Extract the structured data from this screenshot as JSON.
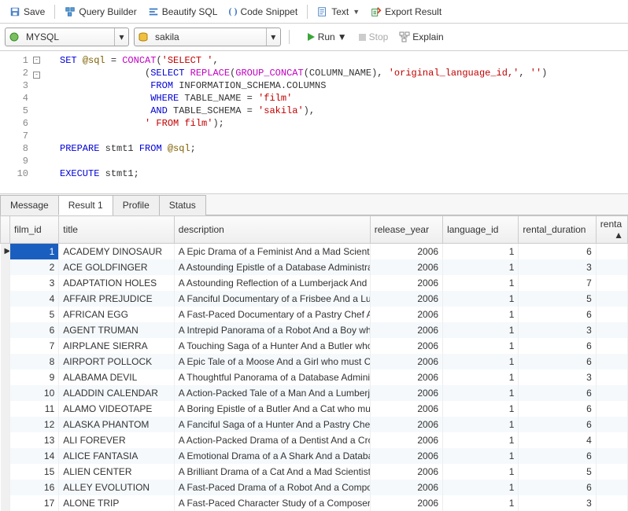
{
  "toolbar": {
    "save": "Save",
    "query_builder": "Query Builder",
    "beautify": "Beautify SQL",
    "snippet": "Code Snippet",
    "text": "Text",
    "export": "Export Result"
  },
  "selectors": {
    "engine": "MYSQL",
    "database": "sakila",
    "run": "Run",
    "stop": "Stop",
    "explain": "Explain"
  },
  "code_lines": [
    {
      "n": "1",
      "fold": "-",
      "html": "<span class='kw'>SET</span> <span class='var'>@sql</span> = <span class='fn'>CONCAT</span>(<span class='str'>'SELECT '</span>,"
    },
    {
      "n": "2",
      "fold": "-",
      "html": "               (<span class='kw'>SELECT</span> <span class='fn'>REPLACE</span>(<span class='fn'>GROUP_CONCAT</span>(COLUMN_NAME), <span class='str'>'original_language_id,'</span>, <span class='str'>''</span>)"
    },
    {
      "n": "3",
      "fold": "",
      "html": "                <span class='kw'>FROM</span> INFORMATION_SCHEMA.COLUMNS"
    },
    {
      "n": "4",
      "fold": "",
      "html": "                <span class='kw'>WHERE</span> TABLE_NAME = <span class='str'>'film'</span>"
    },
    {
      "n": "5",
      "fold": "",
      "html": "                <span class='kw'>AND</span> TABLE_SCHEMA = <span class='str'>'sakila'</span>),"
    },
    {
      "n": "6",
      "fold": "",
      "html": "               <span class='str'>' FROM film'</span>);"
    },
    {
      "n": "7",
      "fold": "",
      "html": ""
    },
    {
      "n": "8",
      "fold": "",
      "html": "<span class='kw'>PREPARE</span> stmt1 <span class='kw'>FROM</span> <span class='var'>@sql</span>;"
    },
    {
      "n": "9",
      "fold": "",
      "html": ""
    },
    {
      "n": "10",
      "fold": "",
      "html": "<span class='kw'>EXECUTE</span> stmt1;"
    }
  ],
  "tabs": [
    "Message",
    "Result 1",
    "Profile",
    "Status"
  ],
  "active_tab": 1,
  "columns": [
    "film_id",
    "title",
    "description",
    "release_year",
    "language_id",
    "rental_duration",
    "renta"
  ],
  "rows": [
    {
      "id": 1,
      "title": "ACADEMY DINOSAUR",
      "desc": "A Epic Drama of a Feminist And a Mad Scientist",
      "year": 2006,
      "lang": 1,
      "dur": 6
    },
    {
      "id": 2,
      "title": "ACE GOLDFINGER",
      "desc": "A Astounding Epistle of a Database Administrat",
      "year": 2006,
      "lang": 1,
      "dur": 3
    },
    {
      "id": 3,
      "title": "ADAPTATION HOLES",
      "desc": "A Astounding Reflection of a Lumberjack And a",
      "year": 2006,
      "lang": 1,
      "dur": 7
    },
    {
      "id": 4,
      "title": "AFFAIR PREJUDICE",
      "desc": "A Fanciful Documentary of a Frisbee And a Lum",
      "year": 2006,
      "lang": 1,
      "dur": 5
    },
    {
      "id": 5,
      "title": "AFRICAN EGG",
      "desc": "A Fast-Paced Documentary of a Pastry Chef An",
      "year": 2006,
      "lang": 1,
      "dur": 6
    },
    {
      "id": 6,
      "title": "AGENT TRUMAN",
      "desc": "A Intrepid Panorama of a Robot And a Boy who",
      "year": 2006,
      "lang": 1,
      "dur": 3
    },
    {
      "id": 7,
      "title": "AIRPLANE SIERRA",
      "desc": "A Touching Saga of a Hunter And a Butler who",
      "year": 2006,
      "lang": 1,
      "dur": 6
    },
    {
      "id": 8,
      "title": "AIRPORT POLLOCK",
      "desc": "A Epic Tale of a Moose And a Girl who must Co",
      "year": 2006,
      "lang": 1,
      "dur": 6
    },
    {
      "id": 9,
      "title": "ALABAMA DEVIL",
      "desc": "A Thoughtful Panorama of a Database Adminis",
      "year": 2006,
      "lang": 1,
      "dur": 3
    },
    {
      "id": 10,
      "title": "ALADDIN CALENDAR",
      "desc": "A Action-Packed Tale of a Man And a Lumberja",
      "year": 2006,
      "lang": 1,
      "dur": 6
    },
    {
      "id": 11,
      "title": "ALAMO VIDEOTAPE",
      "desc": "A Boring Epistle of a Butler And a Cat who mus",
      "year": 2006,
      "lang": 1,
      "dur": 6
    },
    {
      "id": 12,
      "title": "ALASKA PHANTOM",
      "desc": "A Fanciful Saga of a Hunter And a Pastry Chef w",
      "year": 2006,
      "lang": 1,
      "dur": 6
    },
    {
      "id": 13,
      "title": "ALI FOREVER",
      "desc": "A Action-Packed Drama of a Dentist And a Cro",
      "year": 2006,
      "lang": 1,
      "dur": 4
    },
    {
      "id": 14,
      "title": "ALICE FANTASIA",
      "desc": "A Emotional Drama of a A Shark And a Databas",
      "year": 2006,
      "lang": 1,
      "dur": 6
    },
    {
      "id": 15,
      "title": "ALIEN CENTER",
      "desc": "A Brilliant Drama of a Cat And a Mad Scientist w",
      "year": 2006,
      "lang": 1,
      "dur": 5
    },
    {
      "id": 16,
      "title": "ALLEY EVOLUTION",
      "desc": "A Fast-Paced Drama of a Robot And a Compos",
      "year": 2006,
      "lang": 1,
      "dur": 6
    },
    {
      "id": 17,
      "title": "ALONE TRIP",
      "desc": "A Fast-Paced Character Study of a Composer A",
      "year": 2006,
      "lang": 1,
      "dur": 3
    }
  ]
}
